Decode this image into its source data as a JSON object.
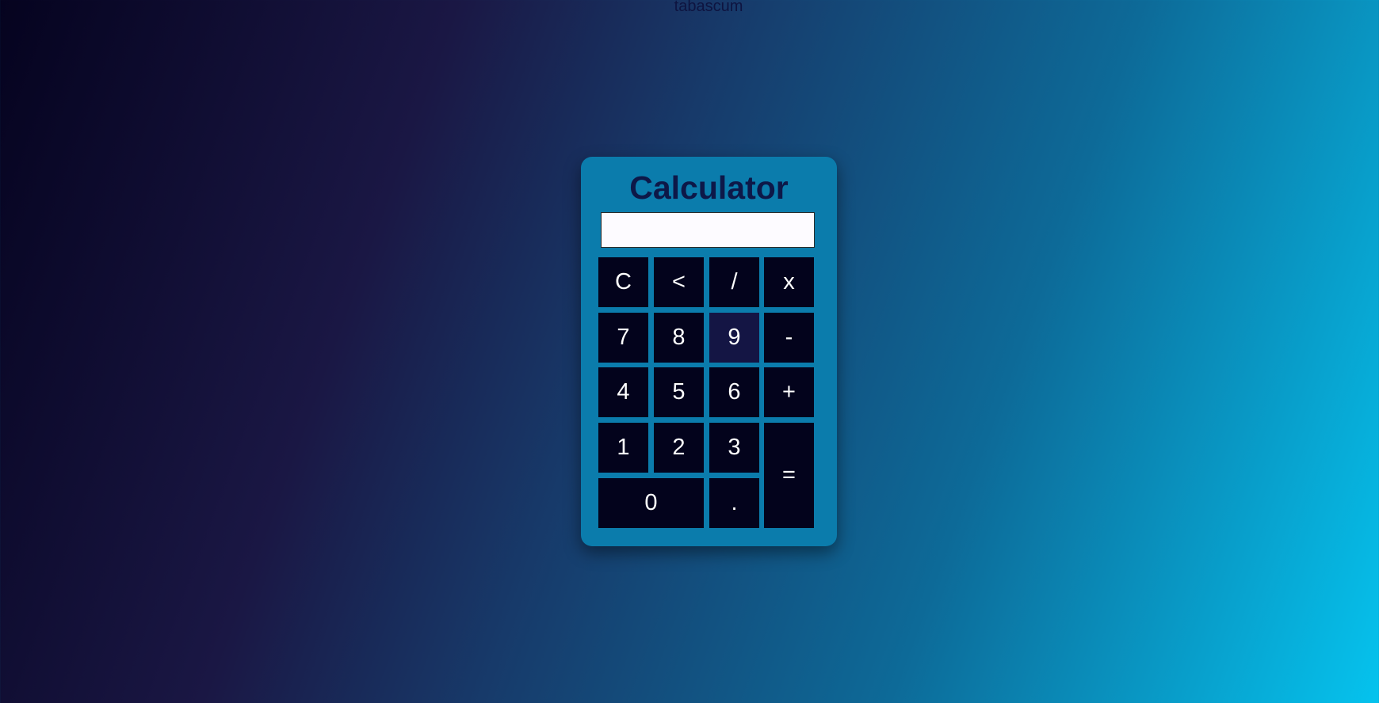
{
  "page": {
    "top_label": "tabascum"
  },
  "calculator": {
    "title": "Calculator",
    "display_value": "",
    "keys": {
      "clear": "C",
      "backspace": "<",
      "divide": "/",
      "multiply": "x",
      "seven": "7",
      "eight": "8",
      "nine": "9",
      "minus": "-",
      "four": "4",
      "five": "5",
      "six": "6",
      "plus": "+",
      "one": "1",
      "two": "2",
      "three": "3",
      "equals": "=",
      "zero": "0",
      "decimal": "."
    }
  },
  "colors": {
    "panel": "#0b7cac",
    "key_bg": "#03031c",
    "key_hover_bg": "#141544",
    "key_text": "#ffffff",
    "title_text": "#0d1848"
  }
}
